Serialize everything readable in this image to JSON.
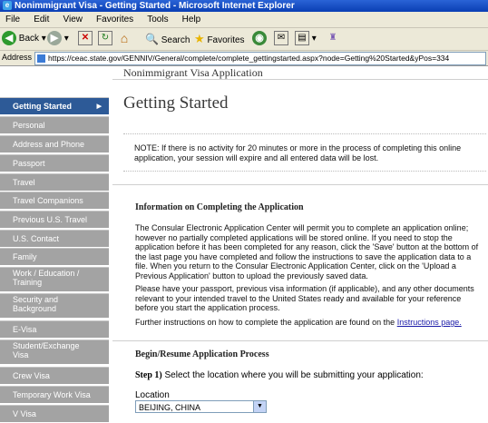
{
  "window": {
    "title": "Nonimmigrant Visa - Getting Started - Microsoft Internet Explorer"
  },
  "menu": [
    "File",
    "Edit",
    "View",
    "Favorites",
    "Tools",
    "Help"
  ],
  "toolbar": {
    "back": "Back",
    "search": "Search",
    "favorites": "Favorites"
  },
  "address": {
    "label": "Address",
    "url": "https://ceac.state.gov/GENNIV/General/complete/complete_gettingstarted.aspx?node=Getting%20Started&yPos=334"
  },
  "sidebar": {
    "items": [
      {
        "label": "Getting Started",
        "active": true
      },
      {
        "label": "Personal"
      },
      {
        "label": "Address and Phone"
      },
      {
        "label": "Passport"
      },
      {
        "label": "Travel"
      },
      {
        "label": "Travel Companions"
      },
      {
        "label": "Previous U.S. Travel"
      },
      {
        "label": "U.S. Contact"
      },
      {
        "label": "Family"
      },
      {
        "label": "Work / Education /",
        "label2": "Training"
      },
      {
        "label": "Security and",
        "label2": "Background"
      },
      {
        "label": "E-Visa"
      },
      {
        "label": "Student/Exchange",
        "label2": "Visa"
      },
      {
        "label": "Crew Visa"
      },
      {
        "label": "Temporary Work Visa"
      },
      {
        "label": "V Visa"
      }
    ]
  },
  "main": {
    "app_title": "Nonimmigrant Visa Application",
    "page_title": "Getting Started",
    "note": "NOTE: If there is no activity for 20 minutes or more in the process of completing this online application, your session will expire and all entered data will be lost.",
    "info_heading": "Information on Completing the Application",
    "info_para1": "The Consular Electronic Application Center will permit you to complete an application online; however no partially completed applications will be stored online. If you need to stop the application before it has been completed for any reason, click the 'Save' button at the bottom of the last page you have completed and follow the instructions to save the application data to a file. When you return to the Consular Electronic Application Center, click on the 'Upload a Previous Application' button to upload the previously saved data.",
    "info_para2": "Please have your passport, previous visa information (if applicable), and any other documents relevant to your intended travel to the United States ready and available for your reference before you start the application process.",
    "info_para3_prefix": "Further instructions on how to complete the application are found on the ",
    "info_para3_link": "Instructions page.",
    "begin_heading": "Begin/Resume Application Process",
    "step1_label": "Step 1)",
    "step1_text": " Select the location where you will be submitting your application:",
    "location_label": "Location",
    "location_value": "BEIJING, CHINA"
  }
}
